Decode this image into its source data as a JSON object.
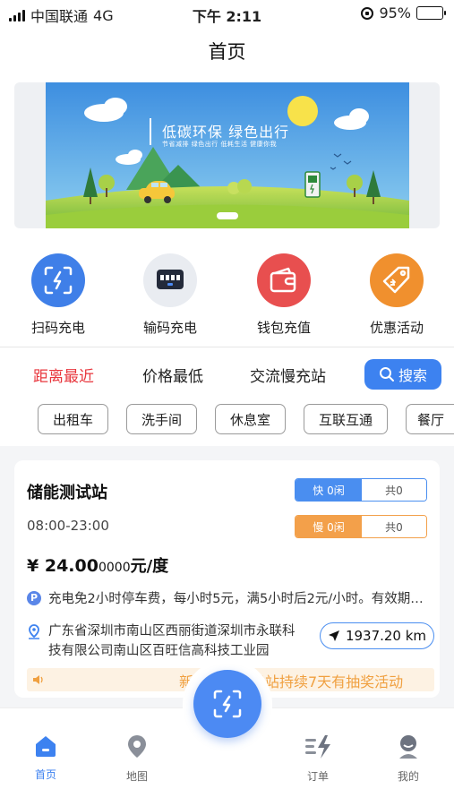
{
  "status_bar": {
    "carrier": "中国联通",
    "network": "4G",
    "time": "下午 2:11",
    "battery": "95%"
  },
  "page_title": "首页",
  "banner": {
    "title": "低碳环保 绿色出行",
    "subtitle": "节省减排 绿色出行 低耗生活 健康你我"
  },
  "actions": [
    {
      "label": "扫码充电",
      "icon": "scan-charge-icon",
      "color": "#3f7fe8"
    },
    {
      "label": "输码充电",
      "icon": "code-input-icon",
      "color": "#e9ecf1"
    },
    {
      "label": "钱包充值",
      "icon": "wallet-icon",
      "color": "#e84f4f"
    },
    {
      "label": "优惠活动",
      "icon": "coupon-tag-icon",
      "color": "#f0902e"
    }
  ],
  "filters": {
    "tabs": [
      "距离最近",
      "价格最低",
      "交流慢充站"
    ],
    "active_tab": "距离最近",
    "search_label": "搜索"
  },
  "chips": [
    "出租车",
    "洗手间",
    "休息室",
    "互联互通",
    "餐厅"
  ],
  "station": {
    "name": "储能测试站",
    "hours": "08:00-23:00",
    "fast": {
      "left": "快 0闲",
      "right": "共0"
    },
    "slow": {
      "left": "慢 0闲",
      "right": "共0"
    },
    "price_symbol": "¥",
    "price_main": "24.00",
    "price_small": "0000",
    "price_unit": "元/度",
    "parking_badge": "P",
    "parking_note": "充电免2小时停车费，每小时5元，满5小时后2元/小时。有效期截至...",
    "address": "广东省深圳市南山区西丽街道深圳市永联科技有限公司南山区百旺信高科技工业园",
    "distance": "1937.20 km",
    "notice": "新站上线，场站持续7天有抽奖活动"
  },
  "tabbar": [
    {
      "label": "首页",
      "icon": "home-icon",
      "active": true
    },
    {
      "label": "地图",
      "icon": "map-pin-icon",
      "active": false
    },
    {
      "label": "订单",
      "icon": "order-list-icon",
      "active": false
    },
    {
      "label": "我的",
      "icon": "profile-icon",
      "active": false
    }
  ],
  "colors": {
    "accent": "#3d82f0",
    "active_filter": "#e8373e",
    "notice": "#f0a040"
  }
}
